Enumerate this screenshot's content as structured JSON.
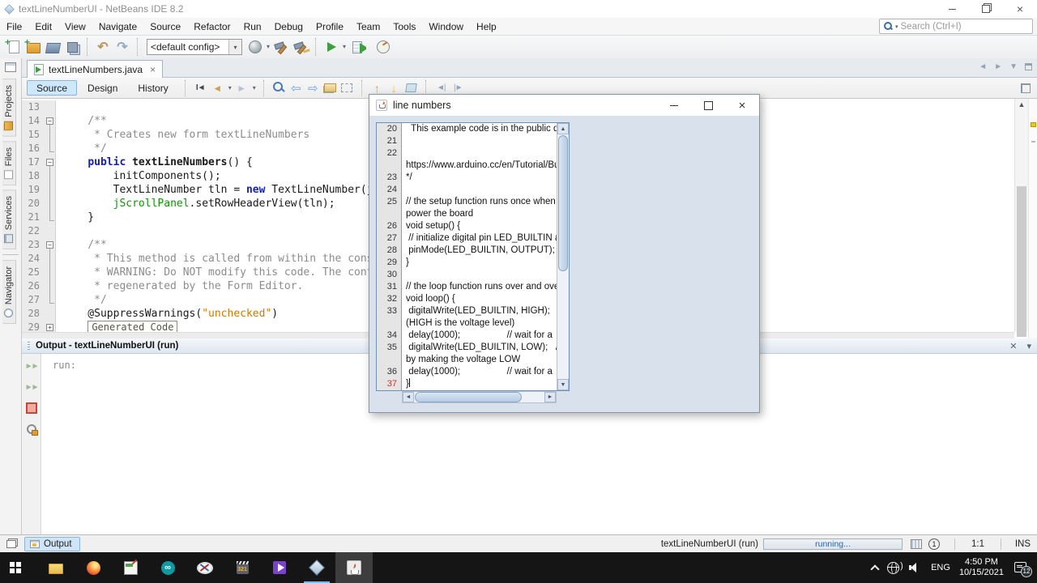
{
  "titlebar": {
    "title": "textLineNumberUI - NetBeans IDE 8.2"
  },
  "menubar": {
    "items": [
      "File",
      "Edit",
      "View",
      "Navigate",
      "Source",
      "Refactor",
      "Run",
      "Debug",
      "Profile",
      "Team",
      "Tools",
      "Window",
      "Help"
    ]
  },
  "search": {
    "placeholder": "Search (Ctrl+I)"
  },
  "toolbar": {
    "config_value": "<default config>",
    "groups": [
      [
        "new-file",
        "new-project",
        "open-project",
        "save-all"
      ],
      [
        "undo",
        "redo"
      ],
      [
        "CONFIG",
        "set-configuration",
        "build-project",
        "clean-and-build"
      ],
      [
        "run-project",
        "debug-project",
        "profile-project"
      ]
    ],
    "dropdown_icons": [
      "set-configuration",
      "run-project",
      "debug-project",
      "profile-project"
    ]
  },
  "sidebar": {
    "tabs": [
      {
        "label": "Projects",
        "icon": "projects-icon"
      },
      {
        "label": "Files",
        "icon": "files-icon"
      },
      {
        "label": "Services",
        "icon": "services-icon"
      },
      {
        "label": "Navigator",
        "icon": "navigator-icon"
      }
    ]
  },
  "editor_tab": {
    "label": "textLineNumbers.java"
  },
  "editor_toolbar": {
    "views": [
      "Source",
      "Design",
      "History"
    ],
    "active_view": "Source",
    "groups": [
      [
        "last-edit-location",
        "back",
        "forward"
      ],
      [
        "find-selection",
        "previous-occurrence",
        "next-occurrence",
        "toggle-highlight-search",
        "toggle-rectangular-selection"
      ],
      [
        "previous-bookmark",
        "next-bookmark",
        "toggle-bookmark"
      ],
      [
        "shift-line-left",
        "shift-line-right"
      ]
    ],
    "dropdown_icons": [
      "back",
      "forward"
    ]
  },
  "editor": {
    "fold_label": "Generated Code",
    "lines": [
      {
        "n": 13,
        "fold": "",
        "segs": []
      },
      {
        "n": 14,
        "fold": "minus",
        "segs": [
          {
            "t": "    /**",
            "c": "cmt"
          }
        ]
      },
      {
        "n": 15,
        "fold": "line",
        "segs": [
          {
            "t": "     * Creates new form textLineNumbers",
            "c": "cmt"
          }
        ]
      },
      {
        "n": 16,
        "fold": "end",
        "segs": [
          {
            "t": "     */",
            "c": "cmt"
          }
        ]
      },
      {
        "n": 17,
        "fold": "minus",
        "segs": [
          {
            "t": "    ",
            "c": ""
          },
          {
            "t": "public",
            "c": "kw"
          },
          {
            "t": " ",
            "c": ""
          },
          {
            "t": "textLineNumbers",
            "c": "meth"
          },
          {
            "t": "() {",
            "c": ""
          }
        ]
      },
      {
        "n": 18,
        "fold": "line",
        "segs": [
          {
            "t": "        initComponents();",
            "c": ""
          }
        ]
      },
      {
        "n": 19,
        "fold": "line",
        "segs": [
          {
            "t": "        TextLineNumber tln = ",
            "c": ""
          },
          {
            "t": "new",
            "c": "kw"
          },
          {
            "t": " TextLineNumber(j",
            "c": ""
          }
        ]
      },
      {
        "n": 20,
        "fold": "line",
        "segs": [
          {
            "t": "        ",
            "c": ""
          },
          {
            "t": "jScrollPanel",
            "c": "grn"
          },
          {
            "t": ".setRowHeaderView(tln);",
            "c": ""
          }
        ]
      },
      {
        "n": 21,
        "fold": "end",
        "segs": [
          {
            "t": "    }",
            "c": ""
          }
        ]
      },
      {
        "n": 22,
        "fold": "",
        "segs": []
      },
      {
        "n": 23,
        "fold": "minus",
        "segs": [
          {
            "t": "    /**",
            "c": "cmt"
          }
        ]
      },
      {
        "n": 24,
        "fold": "line",
        "segs": [
          {
            "t": "     * This method is called from within the cons",
            "c": "cmt"
          }
        ]
      },
      {
        "n": 25,
        "fold": "line",
        "segs": [
          {
            "t": "     * WARNING: Do NOT modify this code. The cont",
            "c": "cmt"
          }
        ]
      },
      {
        "n": 26,
        "fold": "line",
        "segs": [
          {
            "t": "     * regenerated by the Form Editor.",
            "c": "cmt"
          }
        ]
      },
      {
        "n": 27,
        "fold": "end",
        "segs": [
          {
            "t": "     */",
            "c": "cmt"
          }
        ]
      },
      {
        "n": 28,
        "fold": "",
        "segs": [
          {
            "t": "    @SuppressWarnings(",
            "c": ""
          },
          {
            "t": "\"unchecked\"",
            "c": "str"
          },
          {
            "t": ")",
            "c": ""
          }
        ]
      },
      {
        "n": 29,
        "fold": "plus",
        "segs": [
          {
            "t": "    ",
            "c": ""
          }
        ],
        "fold_box": true
      }
    ]
  },
  "output": {
    "title": "Output - textLineNumberUI (run)",
    "console": "run:",
    "icons": [
      "rerun",
      "rerun-debug",
      "stop",
      "ant-settings"
    ]
  },
  "statusbar": {
    "tab": "Output",
    "process": "textLineNumberUI (run)",
    "progress": "running...",
    "notification_count": "1",
    "caret": "1:1",
    "mode": "INS"
  },
  "dialog": {
    "title": "line numbers",
    "rows": [
      {
        "n": "20",
        "t": "  This example code is in the public d"
      },
      {
        "n": "21",
        "t": ""
      },
      {
        "n": "22",
        "t": ""
      },
      {
        "n": "",
        "t": "https://www.arduino.cc/en/Tutorial/Bu"
      },
      {
        "n": "23",
        "t": "*/"
      },
      {
        "n": "24",
        "t": ""
      },
      {
        "n": "25",
        "t": "// the setup function runs once when y"
      },
      {
        "n": "",
        "t": "power the board"
      },
      {
        "n": "26",
        "t": "void setup() {"
      },
      {
        "n": "27",
        "t": " // initialize digital pin LED_BUILTIN a"
      },
      {
        "n": "28",
        "t": " pinMode(LED_BUILTIN, OUTPUT);"
      },
      {
        "n": "29",
        "t": "}"
      },
      {
        "n": "30",
        "t": ""
      },
      {
        "n": "31",
        "t": "// the loop function runs over and over"
      },
      {
        "n": "32",
        "t": "void loop() {"
      },
      {
        "n": "33",
        "t": " digitalWrite(LED_BUILTIN, HIGH);   /"
      },
      {
        "n": "",
        "t": "(HIGH is the voltage level)"
      },
      {
        "n": "34",
        "t": " delay(1000);                  // wait for a"
      },
      {
        "n": "35",
        "t": " digitalWrite(LED_BUILTIN, LOW);   /"
      },
      {
        "n": "",
        "t": "by making the voltage LOW"
      },
      {
        "n": "36",
        "t": " delay(1000);                  // wait for a"
      },
      {
        "n": "37",
        "t": "}",
        "red": true,
        "caret": true
      }
    ]
  },
  "taskbar": {
    "apps": [
      "start",
      "file-explorer",
      "firefox",
      "image-editor",
      "arduino",
      "snipping",
      "mpc",
      "movies",
      "netbeans",
      "java"
    ],
    "running_apps": [
      "netbeans",
      "java"
    ],
    "active_app": "java",
    "lang": "ENG",
    "time": "4:50 PM",
    "date": "10/15/2021",
    "badge": "12"
  },
  "colors": {
    "keyword": "#1521b5",
    "string": "#ce7b00",
    "comment": "#8c8c8c",
    "field_green": "#0a9a00",
    "selected_view": "#cde8fb",
    "error_line_number": "#cc3333",
    "progress_text": "#2e64ac",
    "taskbar_underline": "#76b9ed"
  }
}
